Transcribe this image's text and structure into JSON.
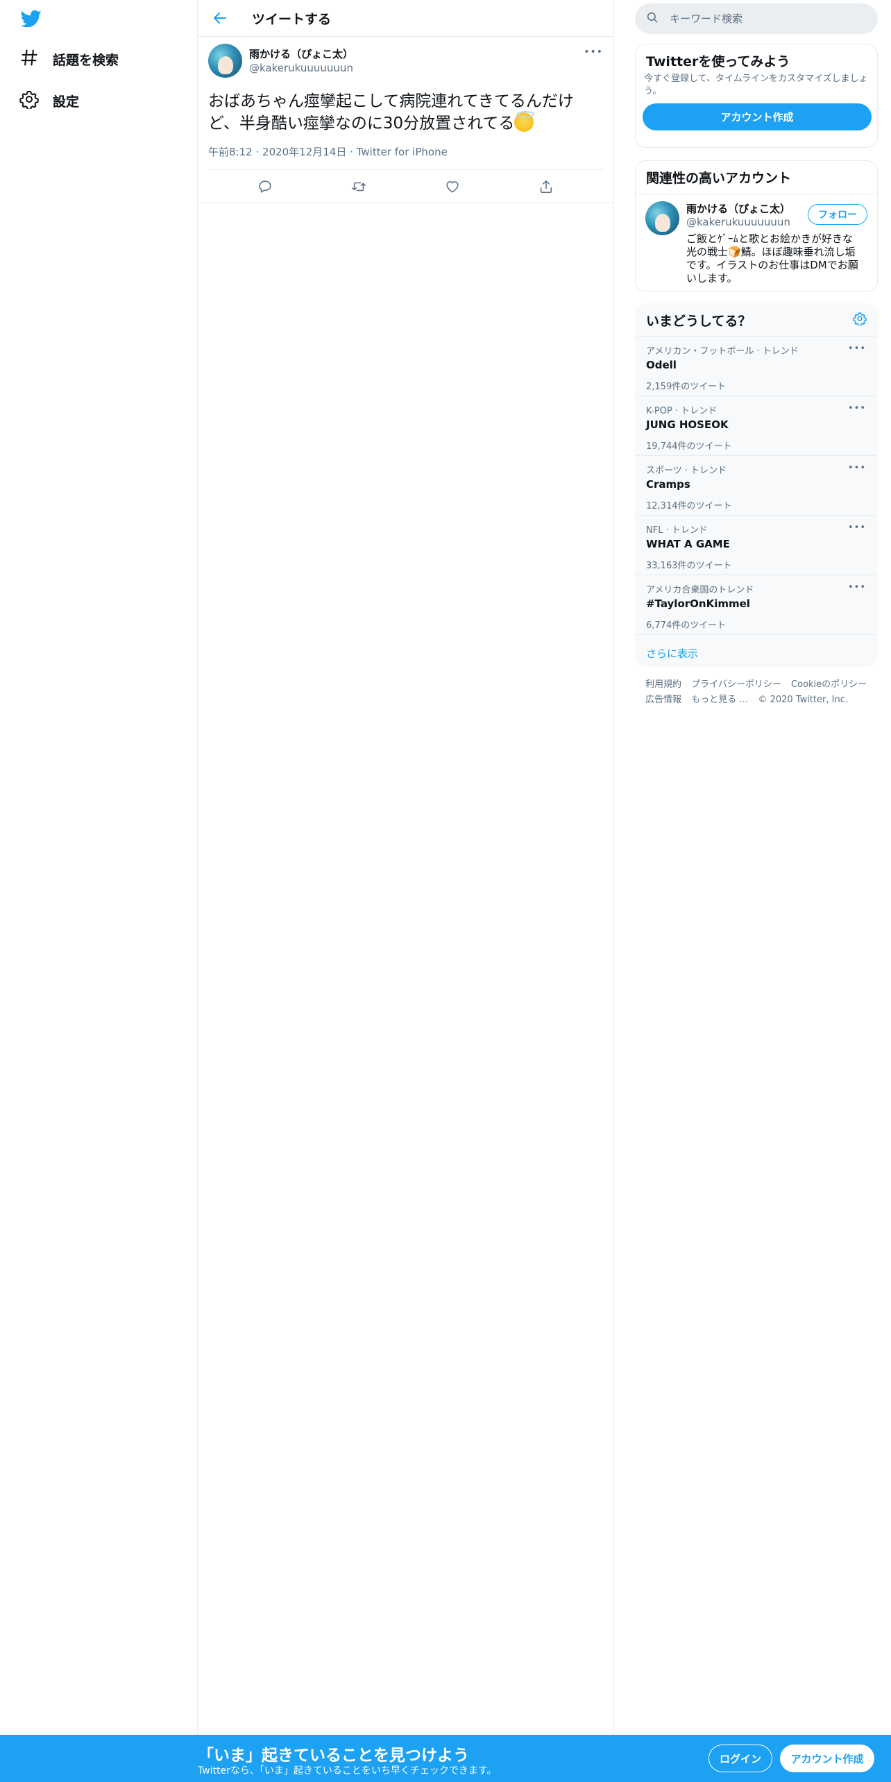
{
  "colors": {
    "accent": "#1da1f2",
    "text": "#0f1419",
    "muted": "#5b7083",
    "border": "#e6ecf0"
  },
  "nav": {
    "logo_icon": "twitter-bird-icon",
    "items": [
      {
        "label": "話題を検索",
        "icon": "hashtag-icon"
      },
      {
        "label": "設定",
        "icon": "gear-icon"
      }
    ]
  },
  "header": {
    "title": "ツイートする",
    "back_icon": "arrow-left-icon"
  },
  "tweet": {
    "author_name": "雨かける（ぴょこ太）",
    "author_handle": "@kakerukuuuuuuun",
    "text": "おばあちゃん痙攣起こして病院連れてきてるんだけど、半身酷い痙攣なのに30分放置されてる",
    "emoji_icon": "smiling-face-with-halo-icon",
    "time": "午前8:12",
    "date": "2020年12月14日",
    "source": "Twitter for iPhone",
    "more_label": "•••"
  },
  "search": {
    "placeholder": "キーワード検索"
  },
  "signup_card": {
    "title": "Twitterを使ってみよう",
    "description": "今すぐ登録して、タイムラインをカスタマイズしましょう。",
    "button": "アカウント作成"
  },
  "related": {
    "title": "関連性の高いアカウント",
    "name": "雨かける（ぴょこ太）",
    "handle": "@kakerukuuuuuuun",
    "bio": "ご飯とｹﾞｰﾑと歌とお絵かきが好きな光の戦士🍞鯖。ほぼ趣味垂れ流し垢です。イラストのお仕事はDMでお願いします。",
    "follow": "フォロー"
  },
  "trends": {
    "title": "いまどうしてる？",
    "items": [
      {
        "category": "アメリカン・フットボール · トレンド",
        "name": "Odell",
        "count": "2,159件のツイート"
      },
      {
        "category": "K-POP · トレンド",
        "name": "JUNG HOSEOK",
        "count": "19,744件のツイート"
      },
      {
        "category": "スポーツ · トレンド",
        "name": "Cramps",
        "count": "12,314件のツイート"
      },
      {
        "category": "NFL · トレンド",
        "name": "WHAT A GAME",
        "count": "33,163件のツイート"
      },
      {
        "category": "アメリカ合衆国のトレンド",
        "name": "#TaylorOnKimmel",
        "count": "6,774件のツイート"
      }
    ],
    "more_label": "•••",
    "show_more": "さらに表示"
  },
  "footer": {
    "terms": "利用規約",
    "privacy": "プライバシーポリシー",
    "cookie": "Cookieのポリシー",
    "ads": "広告情報",
    "more": "もっと見る …",
    "copyright": "© 2020 Twitter, Inc."
  },
  "bottom_bar": {
    "title": "「いま」起きていることを見つけよう",
    "subtitle": "Twitterなら、「いま」起きていることをいち早くチェックできます。",
    "login": "ログイン",
    "signup": "アカウント作成"
  }
}
